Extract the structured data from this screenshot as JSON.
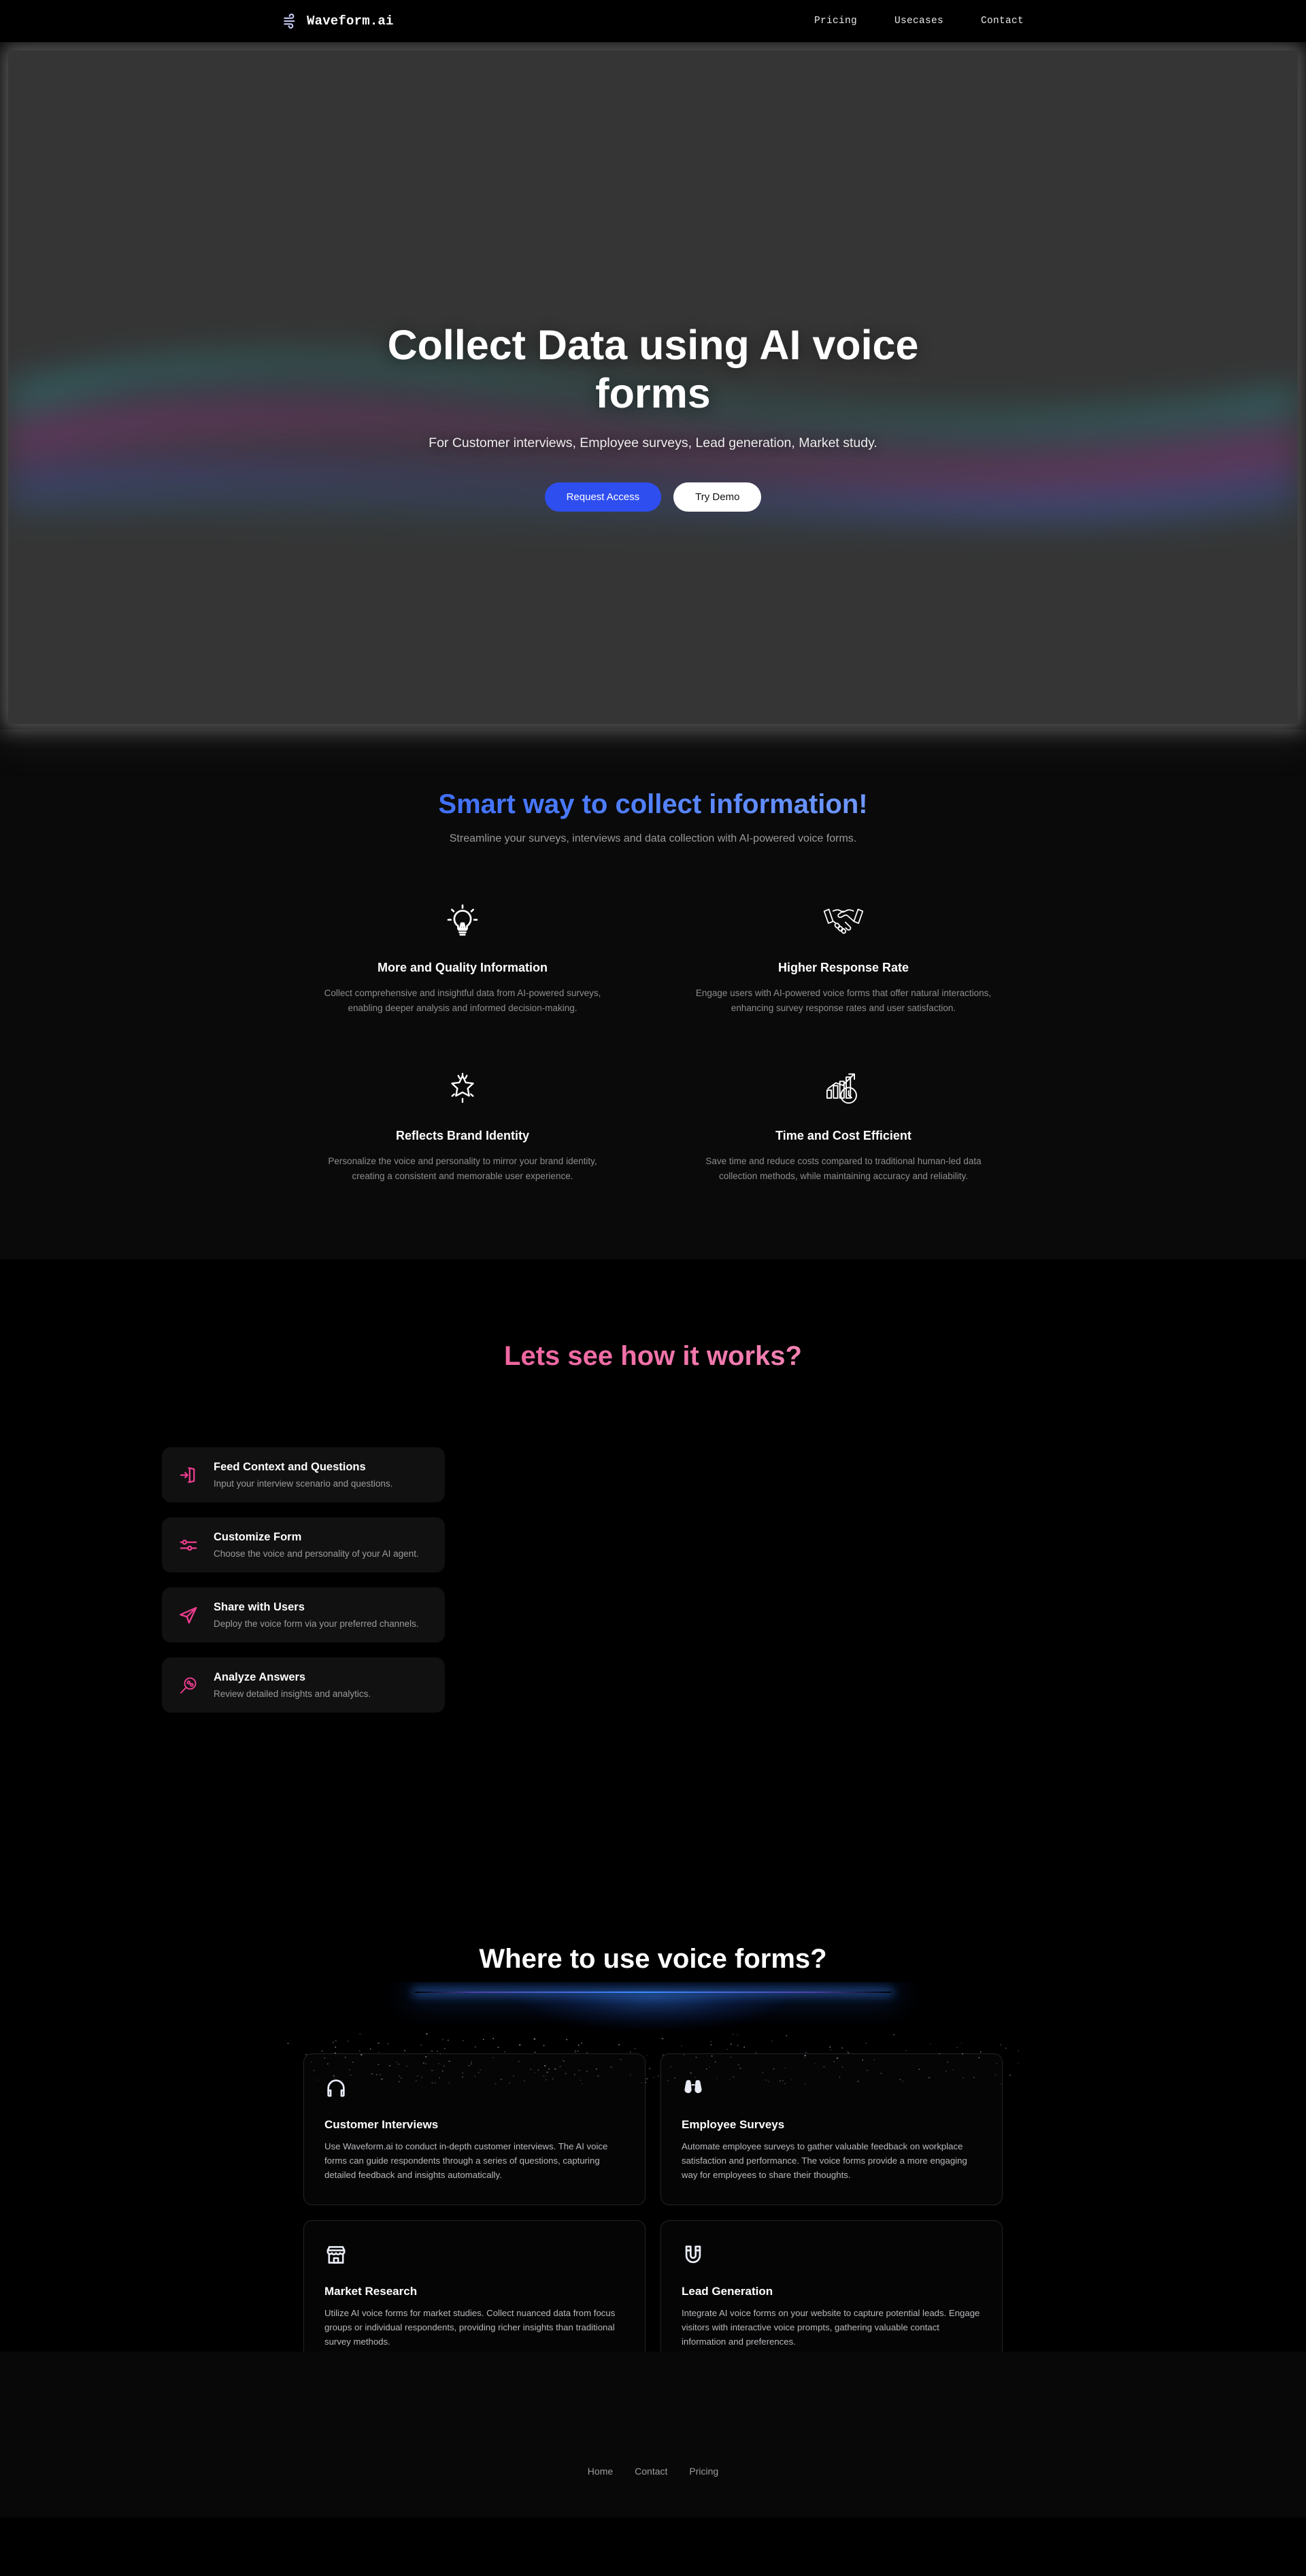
{
  "nav": {
    "logo_text": "Waveform.ai",
    "logo_icon": "wind-icon",
    "links": [
      {
        "label": "Pricing"
      },
      {
        "label": "Usecases"
      },
      {
        "label": "Contact"
      }
    ]
  },
  "hero": {
    "title": "Collect Data using AI voice forms",
    "subtitle": "For Customer interviews, Employee surveys, Lead generation, Market study.",
    "primary_button": "Request Access",
    "secondary_button": "Try Demo",
    "background_color": "#353535",
    "wave_colors": [
      "#2a9d8f",
      "#8e3fa8",
      "#c2409a",
      "#3b63c9"
    ]
  },
  "features_section": {
    "heading": "Smart way to collect information!",
    "heading_gradient": [
      "#2250f5",
      "#a8c6ff"
    ],
    "subheading": "Streamline your surveys, interviews and data collection with AI-powered voice forms.",
    "items": [
      {
        "icon": "lightbulb-icon",
        "title": "More and Quality Information",
        "desc": "Collect comprehensive and insightful data from AI-powered surveys, enabling deeper analysis and informed decision-making."
      },
      {
        "icon": "handshake-icon",
        "title": "Higher Response Rate",
        "desc": "Engage users with AI-powered voice forms that offer natural interactions, enhancing survey response rates and user satisfaction."
      },
      {
        "icon": "star-sparkle-icon",
        "title": "Reflects Brand Identity",
        "desc": "Personalize the voice and personality to mirror your brand identity, creating a consistent and memorable user experience."
      },
      {
        "icon": "chart-clock-icon",
        "title": "Time and Cost Efficient",
        "desc": "Save time and reduce costs compared to traditional human-led data collection methods, while maintaining accuracy and reliability."
      }
    ]
  },
  "how_section": {
    "heading": "Lets see how it works?",
    "heading_gradient": [
      "#e8447f",
      "#f9b8d5"
    ],
    "accent_color": "#ee3d8f",
    "steps": [
      {
        "icon": "login-arrow-icon",
        "title": "Feed Context and Questions",
        "desc": "Input your interview scenario and questions."
      },
      {
        "icon": "sliders-icon",
        "title": "Customize Form",
        "desc": "Choose the voice and personality of your AI agent."
      },
      {
        "icon": "send-icon",
        "title": "Share with Users",
        "desc": "Deploy the voice form via your preferred channels."
      },
      {
        "icon": "magnifier-chart-icon",
        "title": "Analyze Answers",
        "desc": "Review detailed insights and analytics."
      }
    ]
  },
  "usecases_section": {
    "heading": "Where to use voice forms?",
    "beam_color": "#3c8cff",
    "cards": [
      {
        "icon": "headphones-icon",
        "title": "Customer Interviews",
        "desc": "Use Waveform.ai to conduct in-depth customer interviews. The AI voice forms can guide respondents through a series of questions, capturing detailed feedback and insights automatically."
      },
      {
        "icon": "binoculars-icon",
        "title": "Employee Surveys",
        "desc": "Automate employee surveys to gather valuable feedback on workplace satisfaction and performance. The voice forms provide a more engaging way for employees to share their thoughts."
      },
      {
        "icon": "storefront-icon",
        "title": "Market Research",
        "desc": "Utilize AI voice forms for market studies. Collect nuanced data from focus groups or individual respondents, providing richer insights than traditional survey methods."
      },
      {
        "icon": "magnet-icon",
        "title": "Lead Generation",
        "desc": "Integrate AI voice forms on your website to capture potential leads. Engage visitors with interactive voice prompts, gathering valuable contact information and preferences."
      }
    ]
  },
  "footer": {
    "links": [
      {
        "label": "Home"
      },
      {
        "label": "Contact"
      },
      {
        "label": "Pricing"
      }
    ]
  }
}
